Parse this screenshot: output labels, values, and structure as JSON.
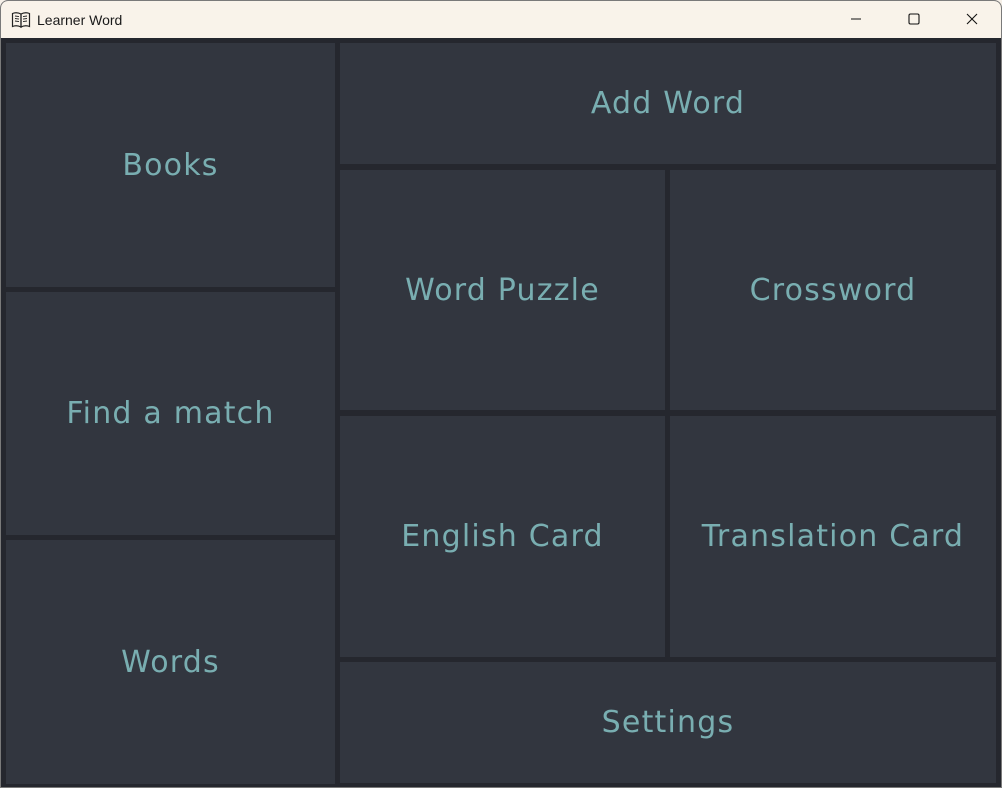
{
  "window": {
    "title": "Learner Word",
    "app_icon": "book-icon",
    "controls": [
      "minimize-icon",
      "maximize-icon",
      "close-icon"
    ]
  },
  "menu": {
    "books": "Books",
    "find_match": "Find a match",
    "words": "Words",
    "add_word": "Add Word",
    "word_puzzle": "Word Puzzle",
    "crossword": "Crossword",
    "english_card": "English Card",
    "translation_card": "Translation Card",
    "settings": "Settings"
  },
  "colors": {
    "tile_background": "#32363f",
    "grid_gap": "#25272e",
    "text_accent": "#79aeb1",
    "titlebar_background": "#f9f3ea"
  }
}
